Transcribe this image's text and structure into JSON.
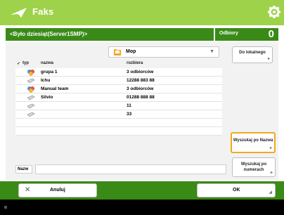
{
  "header": {
    "title": "Faks",
    "app_icon": "fax-plane-icon",
    "settings_icon": "gear-icon"
  },
  "path_bar": {
    "text": "<Było dziesiąt(Server1SMP)>"
  },
  "recipients": {
    "label": "Odbiory",
    "count": "0"
  },
  "location_dropdown": {
    "value": "Mop",
    "icon": "folder-icon"
  },
  "table": {
    "headers": {
      "type": "typ",
      "name": "nazwa",
      "info": "rozbiera"
    },
    "rows": [
      {
        "icon": "folder-stack-icon",
        "name": "grupa 1",
        "value": "3 odbiorców"
      },
      {
        "icon": "computer-icon",
        "name": "Ichu",
        "value": "12288 883 88"
      },
      {
        "icon": "folder-stack-icon",
        "name": "Manual team",
        "value": "3 odbiorców"
      },
      {
        "icon": "computer-icon",
        "name": "Silvio",
        "value": "01288 888 88"
      },
      {
        "icon": "computer-icon",
        "name": "",
        "value": "11"
      },
      {
        "icon": "computer-icon",
        "name": "",
        "value": "33"
      }
    ]
  },
  "buttons": {
    "up": "Do lokalnego",
    "sort_name": "Wyszukaj po Nazwa",
    "sort_date": "Wyszukaj po numerach"
  },
  "filename": {
    "label": "Nazw",
    "value": ""
  },
  "bottom": {
    "cancel": "Anuluj",
    "ok": "OK"
  },
  "colors": {
    "brand_green": "#9ed24a",
    "dark_green": "#3a8a18",
    "highlight": "#f2a81e"
  }
}
